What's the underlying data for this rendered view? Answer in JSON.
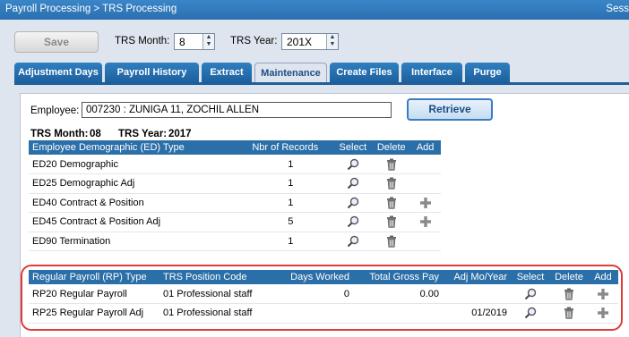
{
  "header": {
    "breadcrumb": "Payroll Processing > TRS Processing",
    "session_text": "Sess"
  },
  "toolbar": {
    "save_label": "Save",
    "trs_month_label": "TRS Month:",
    "trs_month_value": "8",
    "trs_year_label": "TRS Year:",
    "trs_year_value": "201X"
  },
  "tabs": [
    {
      "label": "Adjustment Days"
    },
    {
      "label": "Payroll History"
    },
    {
      "label": "Extract"
    },
    {
      "label": "Maintenance",
      "active": true
    },
    {
      "label": "Create Files"
    },
    {
      "label": "Interface"
    },
    {
      "label": "Purge"
    }
  ],
  "employee": {
    "label": "Employee:",
    "value": "007230 : ZUNIGA 11, ZOCHIL ALLEN",
    "retrieve_label": "Retrieve"
  },
  "trs_info": {
    "month_label": "TRS Month:",
    "month": "08",
    "year_label": "TRS Year:",
    "year": "2017"
  },
  "ed_table": {
    "headers": [
      "Employee Demographic (ED) Type",
      "Nbr of Records",
      "Select",
      "Delete",
      "Add"
    ],
    "rows": [
      {
        "type": "ED20 Demographic",
        "count": "1",
        "add": false
      },
      {
        "type": "ED25 Demographic Adj",
        "count": "1",
        "add": false
      },
      {
        "type": "ED40 Contract & Position",
        "count": "1",
        "add": true
      },
      {
        "type": "ED45 Contract & Position Adj",
        "count": "5",
        "add": true
      },
      {
        "type": "ED90 Termination",
        "count": "1",
        "add": false
      }
    ]
  },
  "rp_table": {
    "headers": [
      "Regular Payroll (RP) Type",
      "TRS Position Code",
      "Days Worked",
      "Total Gross Pay",
      "Adj Mo/Year",
      "Select",
      "Delete",
      "Add"
    ],
    "rows": [
      {
        "type": "RP20 Regular Payroll",
        "position": "01 Professional staff",
        "days": "0",
        "gross": "0.00",
        "adj": ""
      },
      {
        "type": "RP25 Regular Payroll Adj",
        "position": "01 Professional staff",
        "days": "",
        "gross": "",
        "adj": "01/2019"
      }
    ]
  },
  "colors": {
    "header_blue": "#2b6fa8",
    "highlight_red": "#e03a3a",
    "tab_blue": "#1d5f9c"
  }
}
